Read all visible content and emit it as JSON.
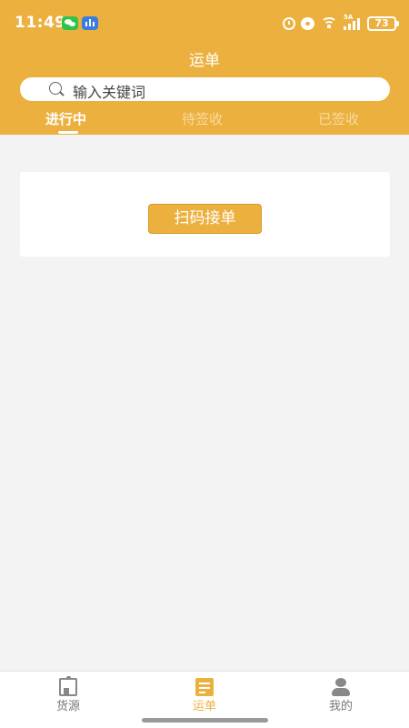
{
  "status_bar": {
    "time": "11:49",
    "battery": "73",
    "signal_label": "5A",
    "icons": [
      "wechat-icon",
      "voice-icon",
      "alarm-icon",
      "message-icon",
      "wifi-icon",
      "signal-icon",
      "battery-icon"
    ]
  },
  "header": {
    "title": "运单",
    "background_color": "#ecb03f"
  },
  "search": {
    "placeholder": "输入关键词"
  },
  "tabs": [
    {
      "label": "进行中",
      "active": true
    },
    {
      "label": "待签收",
      "active": false
    },
    {
      "label": "已签收",
      "active": false
    }
  ],
  "main": {
    "scan_button_label": "扫码接单"
  },
  "tabbar": {
    "items": [
      {
        "label": "货源",
        "icon": "goods-icon",
        "active": false
      },
      {
        "label": "运单",
        "icon": "waybill-icon",
        "active": true
      },
      {
        "label": "我的",
        "icon": "profile-icon",
        "active": false
      }
    ],
    "active_color": "#ecb03f"
  }
}
